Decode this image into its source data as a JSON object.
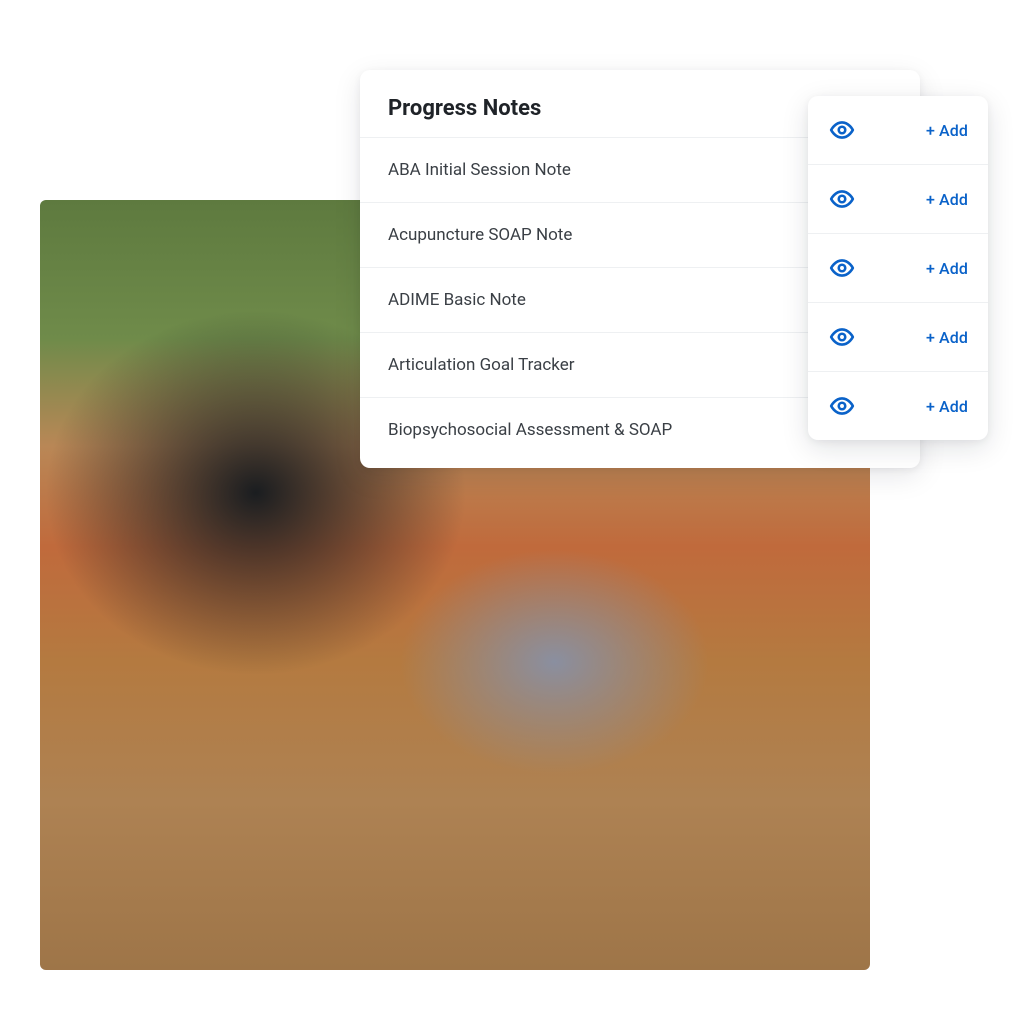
{
  "colors": {
    "accent": "#0a62c9",
    "text": "#1f2328",
    "muted": "#3a3f45",
    "divider": "#eef0f2"
  },
  "notes_card": {
    "title": "Progress Notes",
    "items": [
      {
        "label": "ABA Initial Session Note"
      },
      {
        "label": "Acupuncture SOAP Note"
      },
      {
        "label": "ADIME Basic Note"
      },
      {
        "label": "Articulation Goal Tracker"
      },
      {
        "label": "Biopsychosocial Assessment & SOAP"
      }
    ]
  },
  "actions_card": {
    "rows": [
      {
        "eye_icon": "eye-icon",
        "add_label": "+ Add"
      },
      {
        "eye_icon": "eye-icon",
        "add_label": "+ Add"
      },
      {
        "eye_icon": "eye-icon",
        "add_label": "+ Add"
      },
      {
        "eye_icon": "eye-icon",
        "add_label": "+ Add"
      },
      {
        "eye_icon": "eye-icon",
        "add_label": "+ Add"
      }
    ]
  }
}
